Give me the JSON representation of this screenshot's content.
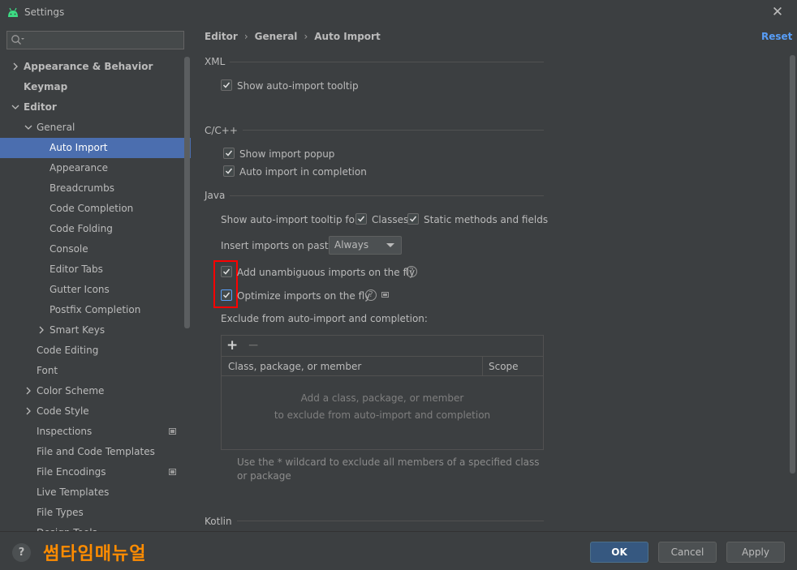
{
  "window": {
    "title": "Settings",
    "app_icon": "android-icon",
    "close_icon": "close-icon"
  },
  "search": {
    "placeholder": "",
    "icon": "search-icon"
  },
  "sidebar": {
    "items": [
      {
        "label": "Appearance & Behavior",
        "level": 0,
        "bold": true,
        "arrow": "right"
      },
      {
        "label": "Keymap",
        "level": 0,
        "bold": true,
        "arrow": "none"
      },
      {
        "label": "Editor",
        "level": 0,
        "bold": true,
        "arrow": "down"
      },
      {
        "label": "General",
        "level": 1,
        "bold": false,
        "arrow": "down"
      },
      {
        "label": "Auto Import",
        "level": 2,
        "bold": false,
        "arrow": "none",
        "selected": true
      },
      {
        "label": "Appearance",
        "level": 2,
        "bold": false,
        "arrow": "none"
      },
      {
        "label": "Breadcrumbs",
        "level": 2,
        "bold": false,
        "arrow": "none"
      },
      {
        "label": "Code Completion",
        "level": 2,
        "bold": false,
        "arrow": "none"
      },
      {
        "label": "Code Folding",
        "level": 2,
        "bold": false,
        "arrow": "none"
      },
      {
        "label": "Console",
        "level": 2,
        "bold": false,
        "arrow": "none"
      },
      {
        "label": "Editor Tabs",
        "level": 2,
        "bold": false,
        "arrow": "none"
      },
      {
        "label": "Gutter Icons",
        "level": 2,
        "bold": false,
        "arrow": "none"
      },
      {
        "label": "Postfix Completion",
        "level": 2,
        "bold": false,
        "arrow": "none"
      },
      {
        "label": "Smart Keys",
        "level": 2,
        "bold": false,
        "arrow": "right"
      },
      {
        "label": "Code Editing",
        "level": 1,
        "bold": false,
        "arrow": "none"
      },
      {
        "label": "Font",
        "level": 1,
        "bold": false,
        "arrow": "none"
      },
      {
        "label": "Color Scheme",
        "level": 1,
        "bold": false,
        "arrow": "right"
      },
      {
        "label": "Code Style",
        "level": 1,
        "bold": false,
        "arrow": "right"
      },
      {
        "label": "Inspections",
        "level": 1,
        "bold": false,
        "arrow": "none",
        "badge": true
      },
      {
        "label": "File and Code Templates",
        "level": 1,
        "bold": false,
        "arrow": "none"
      },
      {
        "label": "File Encodings",
        "level": 1,
        "bold": false,
        "arrow": "none",
        "badge": true
      },
      {
        "label": "Live Templates",
        "level": 1,
        "bold": false,
        "arrow": "none"
      },
      {
        "label": "File Types",
        "level": 1,
        "bold": false,
        "arrow": "none"
      },
      {
        "label": "Design Tools",
        "level": 1,
        "bold": false,
        "arrow": "none"
      }
    ]
  },
  "breadcrumb": {
    "part1": "Editor",
    "part2": "General",
    "part3": "Auto Import"
  },
  "reset_label": "Reset",
  "xml": {
    "title": "XML",
    "show_tooltip": {
      "label": "Show auto-import tooltip",
      "checked": true
    }
  },
  "cpp": {
    "title": "C/C++",
    "show_popup": {
      "label": "Show import popup",
      "checked": true
    },
    "auto_import": {
      "label": "Auto import in completion",
      "checked": true
    }
  },
  "java": {
    "title": "Java",
    "tooltip_for_label": "Show auto-import tooltip for:",
    "classes": {
      "label": "Classes",
      "checked": true
    },
    "static_methods": {
      "label": "Static methods and fields",
      "checked": true
    },
    "paste_label": "Insert imports on paste:",
    "paste_value": "Always",
    "unambiguous": {
      "label": "Add unambiguous imports on the fly",
      "checked": true
    },
    "optimize": {
      "label": "Optimize imports on the fly",
      "checked": true
    },
    "exclude_label": "Exclude from auto-import and completion:",
    "table": {
      "add": "+",
      "remove": "−",
      "col1": "Class, package, or member",
      "col2": "Scope",
      "empty_line1": "Add a class, package, or member",
      "empty_line2": "to exclude from auto-import and completion"
    },
    "hint": "Use the * wildcard to exclude all members of a specified class or package"
  },
  "kotlin": {
    "title": "Kotlin"
  },
  "footer": {
    "help": "?",
    "watermark": "썸타임매뉴얼",
    "ok": "OK",
    "cancel": "Cancel",
    "apply": "Apply"
  },
  "colors": {
    "background": "#3c3f41",
    "selection": "#4b6eaf",
    "link": "#589df6",
    "primary_button": "#365880",
    "highlight_box": "#ff0000",
    "watermark": "#ff8c00"
  }
}
